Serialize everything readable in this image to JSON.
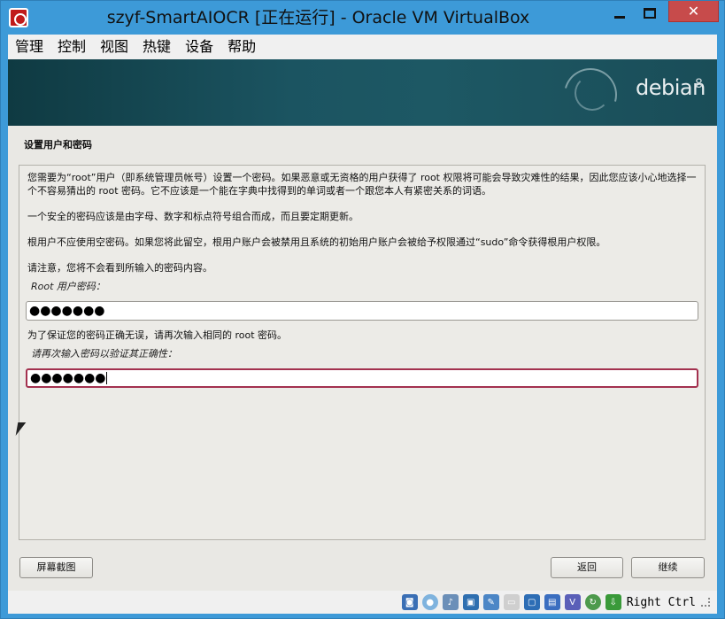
{
  "window": {
    "title": "szyf-SmartAIOCR [正在运行] - Oracle VM VirtualBox",
    "close_glyph": "✕"
  },
  "menu": {
    "items": [
      "管理",
      "控制",
      "视图",
      "热键",
      "设备",
      "帮助"
    ]
  },
  "banner": {
    "logo_text": "debian",
    "version": "8"
  },
  "installer": {
    "section_title": "设置用户和密码",
    "paragraphs": [
      "您需要为“root”用户（即系统管理员帐号）设置一个密码。如果恶意或无资格的用户获得了 root 权限将可能会导致灾难性的结果，因此您应该小心地选择一个不容易猜出的 root 密码。它不应该是一个能在字典中找得到的单词或者一个跟您本人有紧密关系的词语。",
      "一个安全的密码应该是由字母、数字和标点符号组合而成，而且要定期更新。",
      "根用户不应使用空密码。如果您将此留空，根用户账户会被禁用且系统的初始用户账户会被给予权限通过“sudo”命令获得根用户权限。",
      "请注意，您将不会看到所输入的密码内容。"
    ],
    "root_password_label": "Root 用户密码：",
    "root_password_value": "●●●●●●●",
    "verify_note": "为了保证您的密码正确无误，请再次输入相同的 root 密码。",
    "verify_label": "请再次输入密码以验证其正确性：",
    "verify_value": "●●●●●●●"
  },
  "buttons": {
    "screenshot": "屏幕截图",
    "back": "返回",
    "continue": "继续"
  },
  "statusbar": {
    "host_key": "Right Ctrl",
    "icons": [
      "hard-disk-icon",
      "optical-drive-icon",
      "audio-icon",
      "network-icon",
      "usb-icon",
      "shared-folders-icon",
      "display-icon",
      "video-capture-icon",
      "virtualization-icon",
      "mouse-integration-icon",
      "download-icon"
    ]
  },
  "colors": {
    "frame": "#3d9ad8",
    "banner": "#1b5461",
    "focus_border": "#a3314f",
    "close_button": "#c74b4b"
  }
}
